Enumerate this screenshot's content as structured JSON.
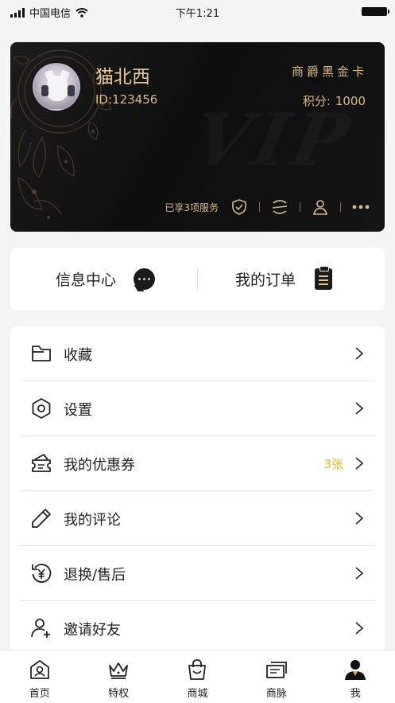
{
  "status_bar": {
    "carrier": "中国电信",
    "time": "下午1:21"
  },
  "vip_card": {
    "username": "猫北西",
    "user_id": "ID:123456",
    "card_type": "商爵黑金卡",
    "points_label": "积分:",
    "points_value": "1000",
    "watermark": "VIP",
    "services_text": "已享3项服务",
    "service_icons": [
      "shield-check-icon",
      "e-logo-icon",
      "person-icon",
      "more-dots-icon"
    ],
    "accent_color": "#d8b98a"
  },
  "quick_actions": [
    {
      "label": "信息中心",
      "icon": "chat-bubble-icon"
    },
    {
      "label": "我的订单",
      "icon": "clipboard-icon"
    }
  ],
  "menu": [
    {
      "label": "收藏",
      "icon": "folder-icon",
      "badge": ""
    },
    {
      "label": "设置",
      "icon": "hexagon-gear-icon",
      "badge": ""
    },
    {
      "label": "我的优惠券",
      "icon": "coupon-icon",
      "badge": "3张"
    },
    {
      "label": "我的评论",
      "icon": "pencil-icon",
      "badge": ""
    },
    {
      "label": "退换/售后",
      "icon": "yen-refresh-icon",
      "badge": ""
    },
    {
      "label": "邀请好友",
      "icon": "add-user-icon",
      "badge": ""
    }
  ],
  "tabbar": [
    {
      "label": "首页",
      "icon": "home-icon",
      "active": false
    },
    {
      "label": "特权",
      "icon": "crown-icon",
      "active": false
    },
    {
      "label": "商城",
      "icon": "shopping-bag-icon",
      "active": false
    },
    {
      "label": "商脉",
      "icon": "cards-icon",
      "active": false
    },
    {
      "label": "我",
      "icon": "profile-icon",
      "active": true
    }
  ],
  "colors": {
    "gold": "#d8b98a",
    "badge_yellow": "#e6b521",
    "card_black": "#111111"
  }
}
